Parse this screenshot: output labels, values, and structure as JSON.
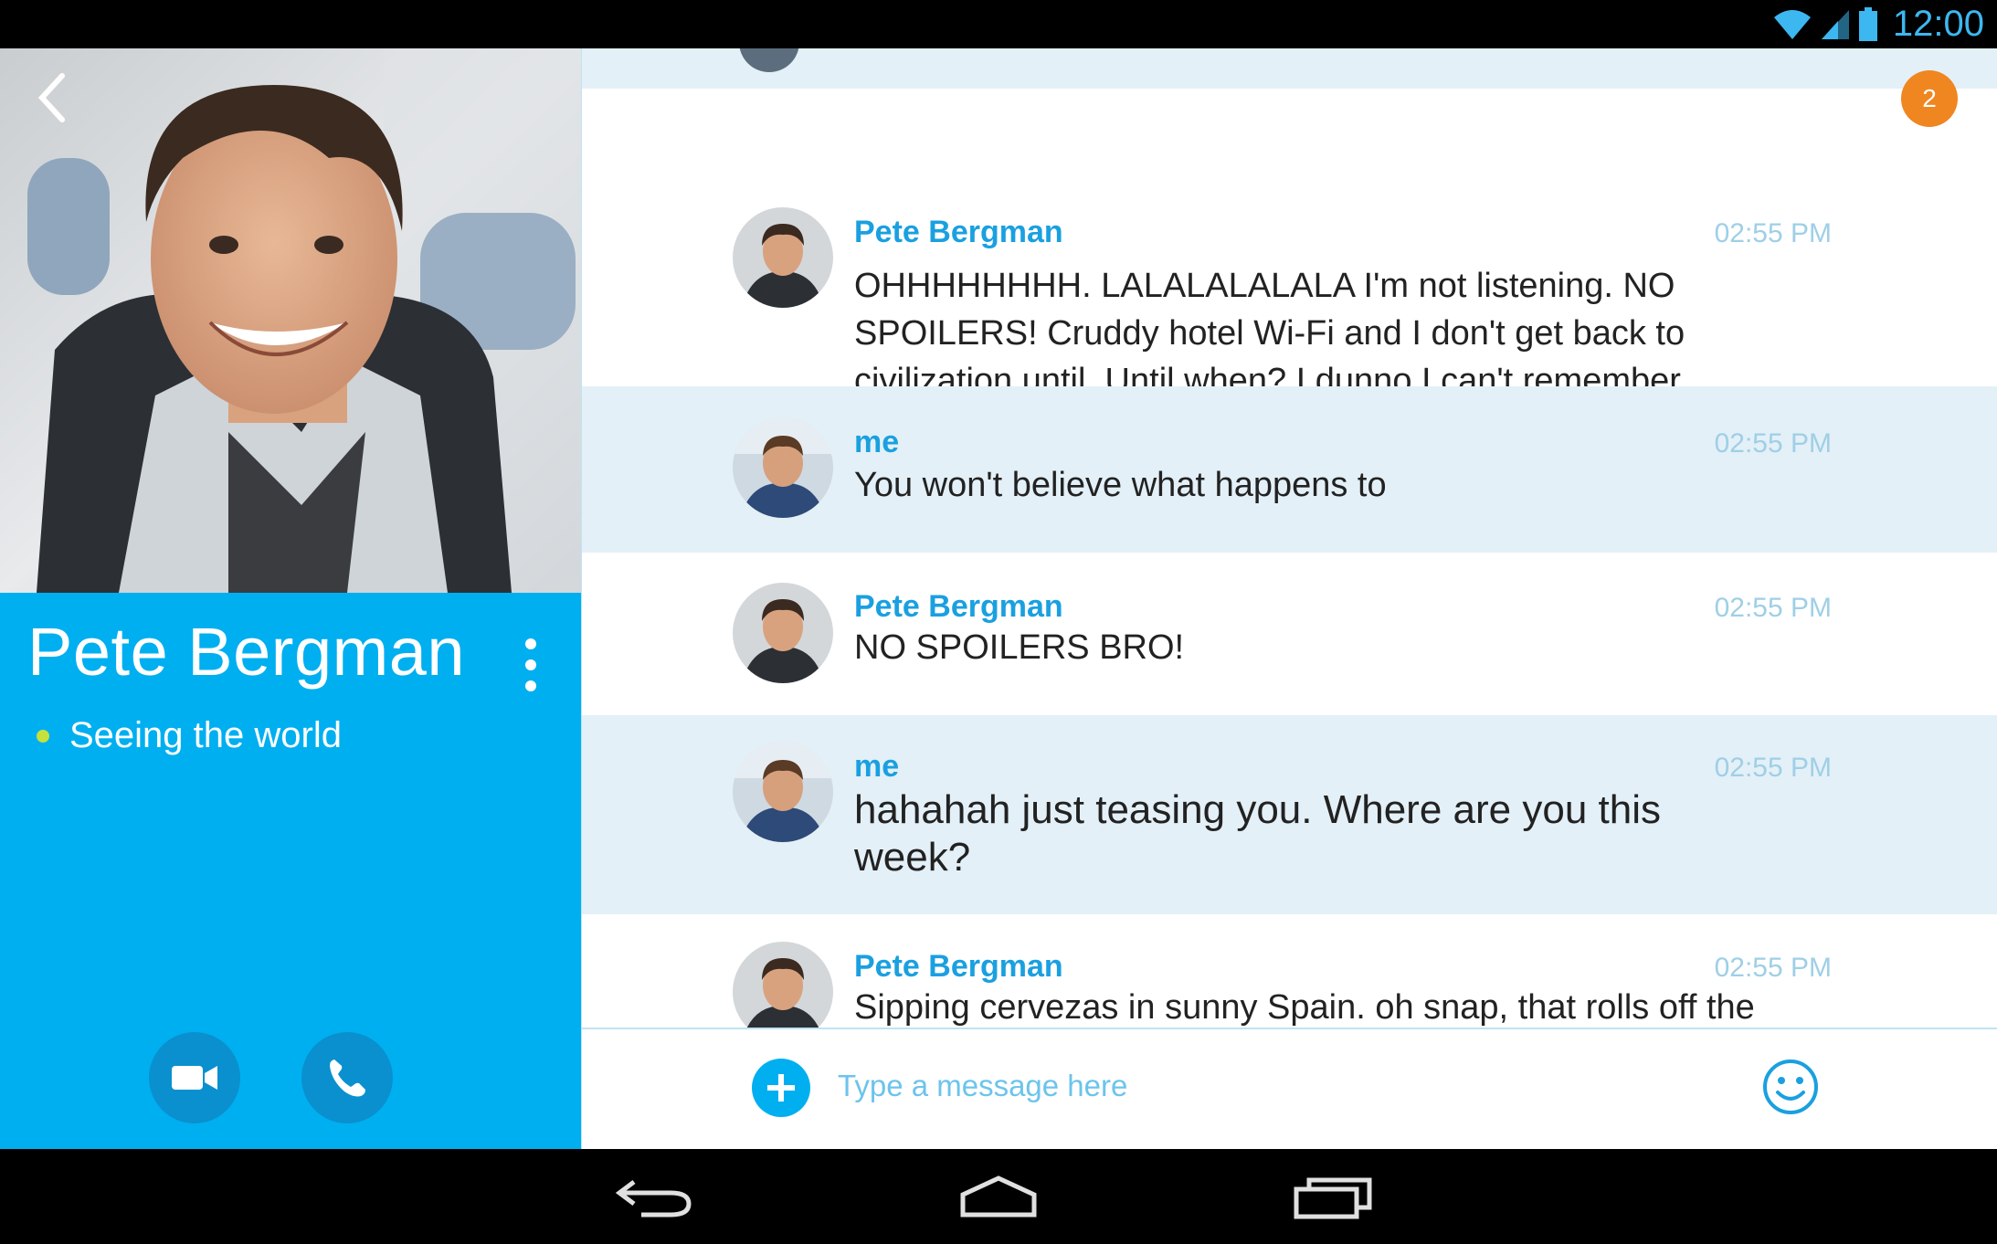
{
  "status_bar": {
    "time": "12:00",
    "icons": [
      "wifi-icon",
      "signal-icon",
      "battery-icon"
    ]
  },
  "profile": {
    "name": "Pete Bergman",
    "status_text": "Seeing the world",
    "presence_color": "#c6e03c",
    "accent_color": "#00aff0",
    "icons": {
      "back": "chevron-left-icon",
      "more": "more-vertical-icon",
      "video": "video-camera-icon",
      "call": "phone-icon"
    }
  },
  "chat": {
    "unread_count": "2",
    "messages": [
      {
        "sender": "Pete Bergman",
        "time": "02:55 PM",
        "text": "OHHHHHHHH. LALALALALALA I'm not listening. NO SPOILERS! Cruddy hotel Wi-Fi and I don't get back to civilization until. Until when? I dunno I can't remember",
        "from_me": false
      },
      {
        "sender": "me",
        "time": "02:55 PM",
        "text": "You won't believe what happens to",
        "from_me": true
      },
      {
        "sender": "Pete Bergman",
        "time": "02:55 PM",
        "text": "NO SPOILERS BRO!",
        "from_me": false
      },
      {
        "sender": "me",
        "time": "02:55 PM",
        "text": "hahahah just teasing you. Where are you this week?",
        "from_me": true
      },
      {
        "sender": "Pete Bergman",
        "time": "02:55 PM",
        "text": "Sipping cervezas in sunny Spain. oh snap, that rolls off the",
        "from_me": false
      }
    ],
    "compose": {
      "placeholder": "Type a message here",
      "value": ""
    },
    "icons": {
      "attach": "plus-circle-icon",
      "emoji": "smiley-icon"
    },
    "colors": {
      "sender_name": "#1aa0e0",
      "timestamp": "#9fcfe6",
      "me_row_bg": "#e3f0f7",
      "badge": "#f0861f"
    }
  },
  "nav_bar": {
    "icons": [
      "back-icon",
      "home-icon",
      "recents-icon"
    ]
  }
}
